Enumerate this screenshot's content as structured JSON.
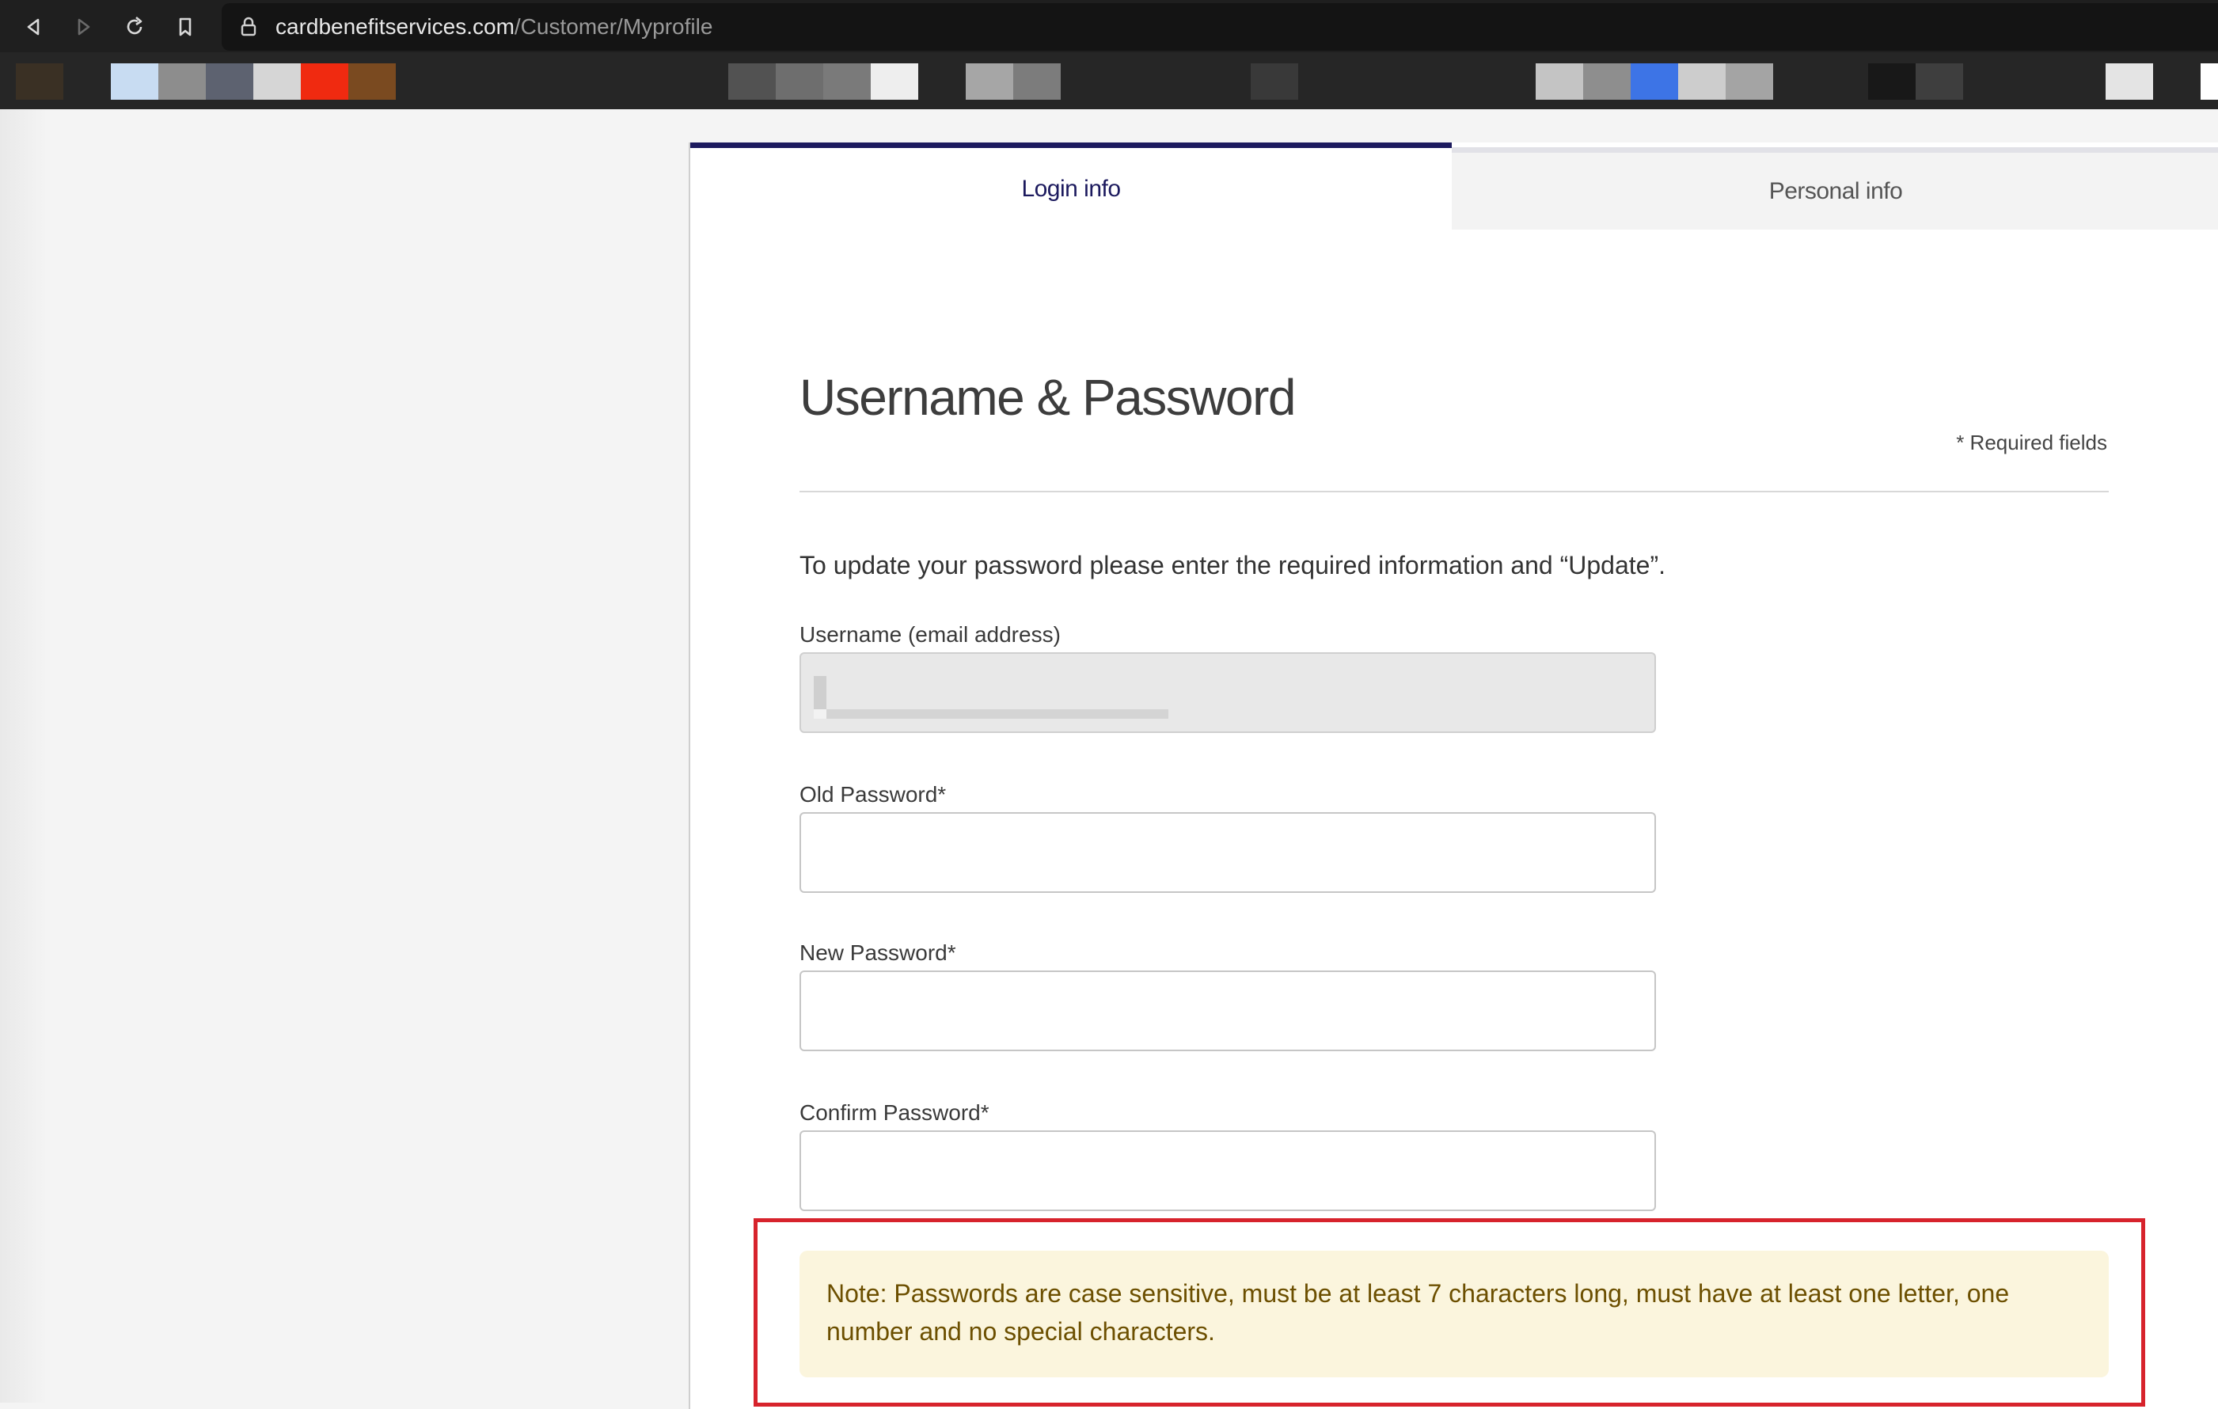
{
  "browser": {
    "url_host": "cardbenefitservices.com",
    "url_path": "/Customer/Myprofile",
    "icons": [
      "back-icon",
      "forward-icon",
      "reload-icon",
      "bookmark-icon",
      "lock-icon"
    ]
  },
  "tabs": {
    "login": "Login info",
    "personal": "Personal info"
  },
  "form": {
    "title": "Username & Password",
    "required_note": "* Required fields",
    "intro": "To update your password please enter the required information and “Update”.",
    "username_label": "Username (email address)",
    "old_password_label": "Old Password*",
    "new_password_label": "New Password*",
    "confirm_password_label": "Confirm Password*"
  },
  "note": "Note: Passwords are case sensitive, must be at least 7 characters long, must have at least one letter, one number and no special characters.",
  "colors": {
    "tab_active_border": "#1c1a5e",
    "note_background": "#fbf5dd",
    "note_text": "#6c4f00",
    "highlight_outline": "#d7232c"
  }
}
